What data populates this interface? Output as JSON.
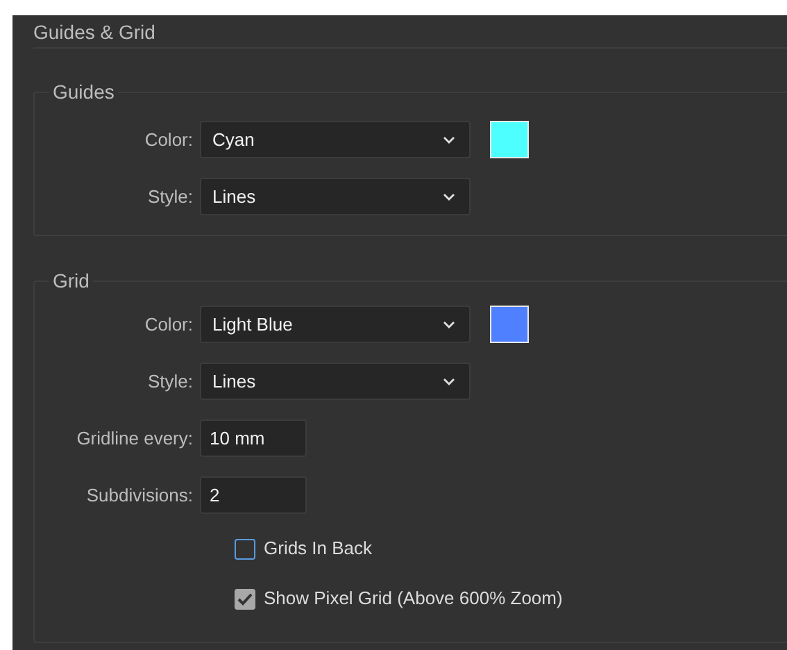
{
  "title": "Guides & Grid",
  "sections": [
    {
      "legend": "Guides",
      "rows": [
        {
          "kind": "dropdown",
          "label": "Color:",
          "value": "Cyan",
          "color": "#4dffff"
        },
        {
          "kind": "dropdown",
          "label": "Style:",
          "value": "Lines"
        }
      ]
    },
    {
      "legend": "Grid",
      "rows": [
        {
          "kind": "dropdown",
          "label": "Color:",
          "value": "Light Blue",
          "color": "#4f80ff"
        },
        {
          "kind": "dropdown",
          "label": "Style:",
          "value": "Lines"
        },
        {
          "kind": "textfield",
          "label": "Gridline every:",
          "value": "10 mm"
        },
        {
          "kind": "textfield",
          "label": "Subdivisions:",
          "value": "2"
        },
        {
          "kind": "checkbox",
          "label": "Grids In Back",
          "checked": false
        },
        {
          "kind": "checkbox",
          "label": "Show Pixel Grid (Above 600% Zoom)",
          "checked": true
        }
      ]
    }
  ]
}
